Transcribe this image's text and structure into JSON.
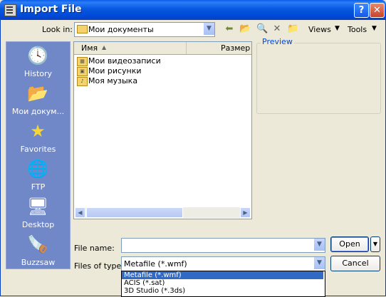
{
  "window": {
    "title": "Import File",
    "help": "?",
    "close": "✕"
  },
  "toolbar": {
    "look_in_label": "Look in:",
    "look_in_value": "Мои документы",
    "views_label": "Views",
    "tools_label": "Tools",
    "icons": [
      "back-icon",
      "up-folder-icon",
      "search-web-icon",
      "delete-icon",
      "new-folder-icon"
    ]
  },
  "places": [
    {
      "label": "History",
      "icon": "history-icon"
    },
    {
      "label": "Мои докум...",
      "icon": "my-documents-icon"
    },
    {
      "label": "Favorites",
      "icon": "favorites-icon"
    },
    {
      "label": "FTP",
      "icon": "ftp-icon"
    },
    {
      "label": "Desktop",
      "icon": "desktop-icon"
    },
    {
      "label": "Buzzsaw",
      "icon": "buzzsaw-icon"
    }
  ],
  "file_list": {
    "columns": [
      "Имя",
      "Размер"
    ],
    "items": [
      "Мои видеозаписи",
      "Мои рисунки",
      "Моя музыка"
    ]
  },
  "preview": {
    "label": "Preview"
  },
  "fields": {
    "file_name_label": "File name:",
    "file_name_value": "",
    "files_of_type_label": "Files of type:",
    "files_of_type_value": "Metafile (*.wmf)"
  },
  "buttons": {
    "open": "Open",
    "cancel": "Cancel"
  },
  "type_options": [
    "Metafile (*.wmf)",
    "ACIS (*.sat)",
    "3D Studio (*.3ds)"
  ],
  "colors": {
    "title_bar": "#0058e6",
    "places_bar": "#7088c8",
    "selection": "#316ac5"
  }
}
